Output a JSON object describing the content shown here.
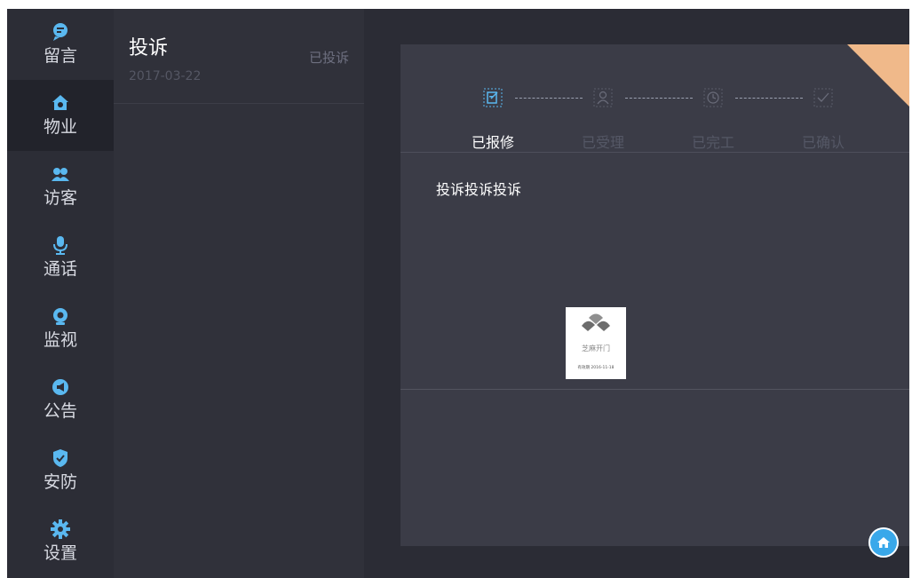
{
  "sidebar": {
    "items": [
      {
        "label": "留言",
        "icon": "message-icon"
      },
      {
        "label": "物业",
        "icon": "property-icon",
        "active": true
      },
      {
        "label": "访客",
        "icon": "visitor-icon"
      },
      {
        "label": "通话",
        "icon": "microphone-icon"
      },
      {
        "label": "监视",
        "icon": "camera-icon"
      },
      {
        "label": "公告",
        "icon": "megaphone-icon"
      },
      {
        "label": "安防",
        "icon": "shield-icon"
      },
      {
        "label": "设置",
        "icon": "gear-icon"
      }
    ]
  },
  "list": {
    "items": [
      {
        "title": "投诉",
        "status": "已投诉",
        "date": "2017-03-22"
      }
    ]
  },
  "detail": {
    "steps": [
      {
        "label": "已报修",
        "icon": "edit-icon",
        "active": true
      },
      {
        "label": "已受理",
        "icon": "user-icon",
        "active": false
      },
      {
        "label": "已完工",
        "icon": "clock-icon",
        "active": false
      },
      {
        "label": "已确认",
        "icon": "check-icon",
        "active": false
      }
    ],
    "content": "投诉投诉投诉",
    "attachment": {
      "brand": "芝麻开门",
      "validity": "有效期 2016-11-18"
    }
  },
  "colors": {
    "accent": "#39a8ea",
    "corner": "#f0b98a",
    "background": "#2b2c35"
  },
  "home_button": {
    "icon": "home-icon"
  }
}
